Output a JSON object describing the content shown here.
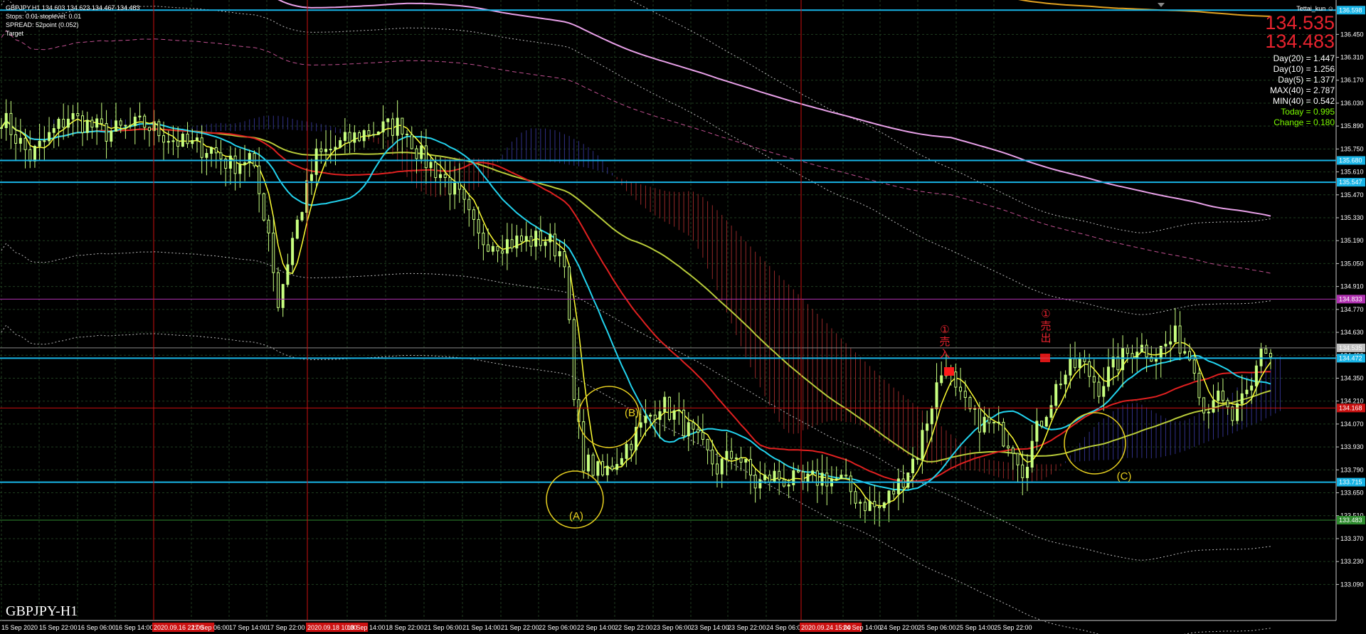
{
  "header": {
    "symbol_line": "GBPJPY,H1  134.603 134.623 134.467 134.483",
    "stops_line": "Stops: 0.01  stoplevel: 0.01",
    "spread_line": "SPREAD: 52point (0.052)",
    "target_line": "Target",
    "user": "Tettai_kun"
  },
  "price_box": {
    "ask": "134.535",
    "bid": "134.483"
  },
  "stats": [
    {
      "text": "Day(20) = 1.447",
      "color": "#ffffff"
    },
    {
      "text": "Day(10) = 1.256",
      "color": "#ffffff"
    },
    {
      "text": "Day(5) = 1.377",
      "color": "#ffffff"
    },
    {
      "text": "MAX(40) = 2.787",
      "color": "#ffffff"
    },
    {
      "text": "MIN(40) = 0.542",
      "color": "#ffffff"
    },
    {
      "text": "Today = 0.995",
      "color": "#7cfc00"
    },
    {
      "text": "Change = 0.180",
      "color": "#7cfc00"
    }
  ],
  "watermark": "GBPJPY-H1",
  "chart_data": {
    "type": "line",
    "title": "GBPJPY,H1",
    "ylim": [
      132.87,
      136.66
    ],
    "y_ticks": [
      "136.450",
      "136.310",
      "136.170",
      "136.030",
      "135.890",
      "135.750",
      "135.610",
      "135.470",
      "135.330",
      "135.190",
      "135.050",
      "134.910",
      "134.770",
      "134.630",
      "134.490",
      "134.350",
      "134.210",
      "134.070",
      "133.930",
      "133.790",
      "133.650",
      "133.510",
      "133.370",
      "133.230",
      "133.090"
    ],
    "x_ticks": [
      "15 Sep 2020",
      "15 Sep 22:00",
      "16 Sep 06:00",
      "16 Sep 14:00",
      "2020.09.16 22:00",
      "17 Sep 06:00",
      "17 Sep 14:00",
      "17 Sep 22:00",
      "2020.09.18 10:00",
      "18 Sep 14:00",
      "18 Sep 22:00",
      "21 Sep 06:00",
      "21 Sep 14:00",
      "21 Sep 22:00",
      "22 Sep 06:00",
      "22 Sep 14:00",
      "22 Sep 22:00",
      "23 Sep 06:00",
      "23 Sep 14:00",
      "23 Sep 22:00",
      "24 Sep 06:00",
      "2020.09.24 15:00",
      "24 Sep 14:00",
      "24 Sep 22:00",
      "25 Sep 06:00",
      "25 Sep 14:00",
      "25 Sep 22:00"
    ],
    "x_ticks_highlighted": [
      "2020.09.16 22:00",
      "2020.09.18 10:00",
      "2020.09.24 15:00"
    ],
    "price_labels": [
      {
        "value": "136.598",
        "color": "#18b4e6"
      },
      {
        "value": "135.680",
        "color": "#18b4e6"
      },
      {
        "value": "135.547",
        "color": "#18b4e6"
      },
      {
        "value": "134.833",
        "color": "#b030b0"
      },
      {
        "value": "134.535",
        "color": "#c0c0c0"
      },
      {
        "value": "134.472",
        "color": "#18b4e6"
      },
      {
        "value": "134.168",
        "color": "#cc1111"
      },
      {
        "value": "133.715",
        "color": "#18b4e6"
      },
      {
        "value": "133.483",
        "color": "#2e8b2e"
      }
    ],
    "horizontal_lines": [
      {
        "price": 136.598,
        "color": "#18b4e6"
      },
      {
        "price": 135.68,
        "color": "#18b4e6"
      },
      {
        "price": 135.547,
        "color": "#18b4e6"
      },
      {
        "price": 134.833,
        "color": "#b030b0"
      },
      {
        "price": 134.535,
        "color": "#888888"
      },
      {
        "price": 134.472,
        "color": "#18b4e6"
      },
      {
        "price": 134.168,
        "color": "#cc1111"
      },
      {
        "price": 133.715,
        "color": "#18b4e6"
      },
      {
        "price": 133.483,
        "color": "#2e8b2e"
      }
    ],
    "vertical_lines": [
      {
        "x_label": "2020.09.16 22:00"
      },
      {
        "x_label": "2020.09.18 10:00"
      },
      {
        "x_label": "2020.09.24 15:00"
      }
    ],
    "annotations": [
      {
        "text": "(A)",
        "color": "#e8d020"
      },
      {
        "text": "(B)",
        "color": "#e8d020"
      },
      {
        "text": "(C)",
        "color": "#e8d020"
      },
      {
        "text": "①売入",
        "color": "#e8232e"
      },
      {
        "text": "①売出",
        "color": "#e8232e"
      }
    ],
    "grid": true,
    "legend": "none",
    "colors": {
      "background": "#000000",
      "candle": "#c8ff80",
      "fast_ma": "#ffff33",
      "mid_ma": "#22d3ee",
      "red_ma": "#e02020",
      "olive_ma": "#b9cc3a",
      "pink_ma": "#e8a0e8",
      "orange_ma": "#e0a020",
      "cloud_red": "#b03030",
      "cloud_blue": "#3a3aa0"
    }
  }
}
